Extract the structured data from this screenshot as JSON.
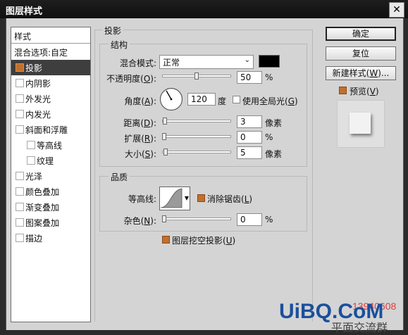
{
  "window": {
    "title": "图层样式",
    "close": "✕"
  },
  "styles_panel": {
    "header": "样式",
    "items": [
      {
        "label": "混合选项:自定",
        "checkbox": false,
        "indent": 0
      },
      {
        "label": "投影",
        "checkbox": true,
        "checked": true,
        "selected": true,
        "indent": 0
      },
      {
        "label": "内阴影",
        "checkbox": true,
        "checked": false,
        "indent": 0
      },
      {
        "label": "外发光",
        "checkbox": true,
        "checked": false,
        "indent": 0
      },
      {
        "label": "内发光",
        "checkbox": true,
        "checked": false,
        "indent": 0
      },
      {
        "label": "斜面和浮雕",
        "checkbox": true,
        "checked": false,
        "indent": 0
      },
      {
        "label": "等高线",
        "checkbox": true,
        "checked": false,
        "indent": 1
      },
      {
        "label": "纹理",
        "checkbox": true,
        "checked": false,
        "indent": 1
      },
      {
        "label": "光泽",
        "checkbox": true,
        "checked": false,
        "indent": 0
      },
      {
        "label": "颜色叠加",
        "checkbox": true,
        "checked": false,
        "indent": 0
      },
      {
        "label": "渐变叠加",
        "checkbox": true,
        "checked": false,
        "indent": 0
      },
      {
        "label": "图案叠加",
        "checkbox": true,
        "checked": false,
        "indent": 0
      },
      {
        "label": "描边",
        "checkbox": true,
        "checked": false,
        "indent": 0
      }
    ]
  },
  "drop_shadow": {
    "title": "投影",
    "structure": {
      "title": "结构",
      "blend_mode": {
        "label": "混合模式:",
        "value": "正常",
        "color": "#000000"
      },
      "opacity": {
        "label_pre": "不透明度(",
        "key": "O",
        "label_post": "):",
        "value": "50",
        "unit": "%",
        "fraction": 0.5
      },
      "angle": {
        "label_pre": "角度(",
        "key": "A",
        "label_post": "):",
        "value": "120",
        "unit": "度",
        "degrees": 120
      },
      "global_light": {
        "label_pre": "使用全局光(",
        "key": "G",
        "label_post": ")",
        "checked": false
      },
      "distance": {
        "label_pre": "距离(",
        "key": "D",
        "label_post": "):",
        "value": "3",
        "unit": "像素",
        "fraction": 0.012
      },
      "spread": {
        "label_pre": "扩展(",
        "key": "R",
        "label_post": "):",
        "value": "0",
        "unit": "%",
        "fraction": 0
      },
      "size": {
        "label_pre": "大小(",
        "key": "S",
        "label_post": "):",
        "value": "5",
        "unit": "像素",
        "fraction": 0.02
      }
    },
    "quality": {
      "title": "品质",
      "contour": {
        "label": "等高线:"
      },
      "anti_alias": {
        "label_pre": "消除锯齿(",
        "key": "L",
        "label_post": ")",
        "checked": true
      },
      "noise": {
        "label_pre": "杂色(",
        "key": "N",
        "label_post": "):",
        "value": "0",
        "unit": "%",
        "fraction": 0
      }
    },
    "knockout": {
      "label_pre": "图层挖空投影(",
      "key": "U",
      "label_post": ")",
      "checked": true
    }
  },
  "buttons": {
    "ok": "确定",
    "reset": "复位",
    "new_style_pre": "新建样式(",
    "new_style_key": "W",
    "new_style_post": ")...",
    "preview_pre": "预览(",
    "preview_key": "V",
    "preview_post": ")",
    "preview_checked": true
  },
  "watermark": {
    "site": "UiBQ.CoM",
    "number": "13940608",
    "tail": "平面交流群"
  },
  "colors": {
    "accent": "#c06f2e",
    "selection_bg": "#3e3e3e",
    "dialog_bg": "#d4d4d4",
    "watermark_red": "#e23a3a",
    "watermark_blue": "#1a4f9c"
  }
}
